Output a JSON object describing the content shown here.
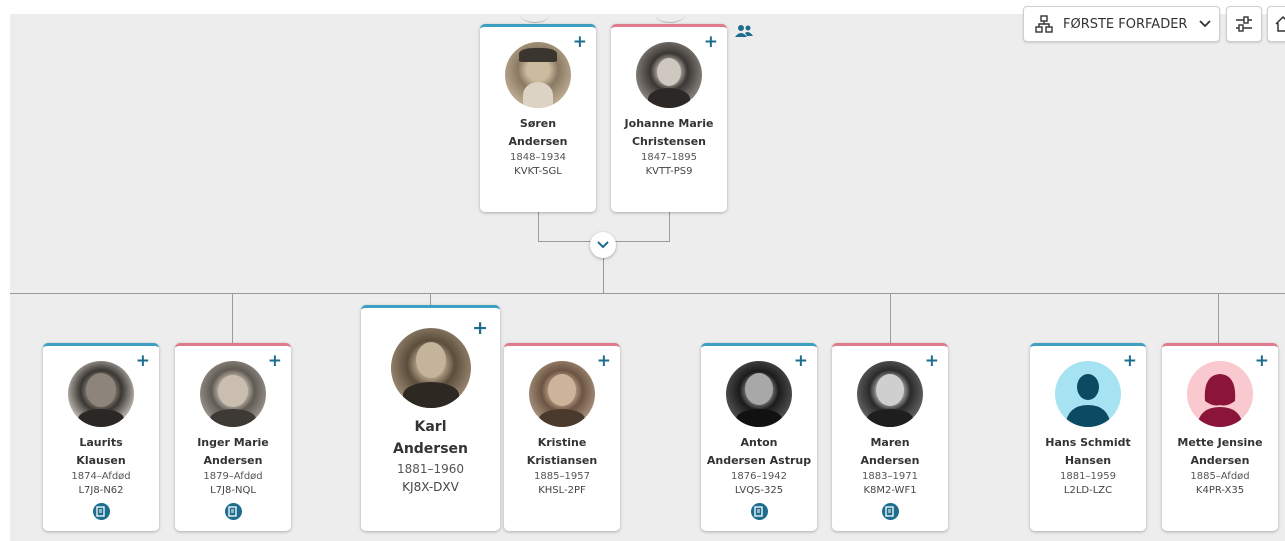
{
  "toolbar": {
    "view_label": "FØRSTE FORFADER"
  },
  "colors": {
    "male": "#3d9fc1",
    "female": "#e07b8e",
    "accent": "#1d6d8e",
    "background": "#ededed"
  },
  "people": {
    "soren": {
      "first": "Søren",
      "last": "Andersen",
      "dates": "1848–1934",
      "pid": "KVKT-SGL"
    },
    "johanne": {
      "first": "Johanne Marie",
      "last": "Christensen",
      "dates": "1847–1895",
      "pid": "KVTT-PS9"
    },
    "laurits": {
      "first": "Laurits",
      "last": "Klausen",
      "dates": "1874–Afdød",
      "pid": "L7J8-N62"
    },
    "inger": {
      "first": "Inger Marie",
      "last": "Andersen",
      "dates": "1879–Afdød",
      "pid": "L7J8-NQL"
    },
    "karl": {
      "first": "Karl",
      "last": "Andersen",
      "dates": "1881–1960",
      "pid": "KJ8X-DXV"
    },
    "kristine": {
      "first": "Kristine",
      "last": "Kristiansen",
      "dates": "1885–1957",
      "pid": "KHSL-2PF"
    },
    "anton": {
      "first": "Anton",
      "last": "Andersen Astrup",
      "dates": "1876–1942",
      "pid": "LVQS-325"
    },
    "maren": {
      "first": "Maren",
      "last": "Andersen",
      "dates": "1883–1971",
      "pid": "K8M2-WF1"
    },
    "hans": {
      "first": "Hans Schmidt",
      "last": "Hansen",
      "dates": "1881–1959",
      "pid": "L2LD-LZC"
    },
    "mette": {
      "first": "Mette Jensine",
      "last": "Andersen",
      "dates": "1885–Afdød",
      "pid": "K4PR-X35"
    }
  },
  "plus": "+"
}
